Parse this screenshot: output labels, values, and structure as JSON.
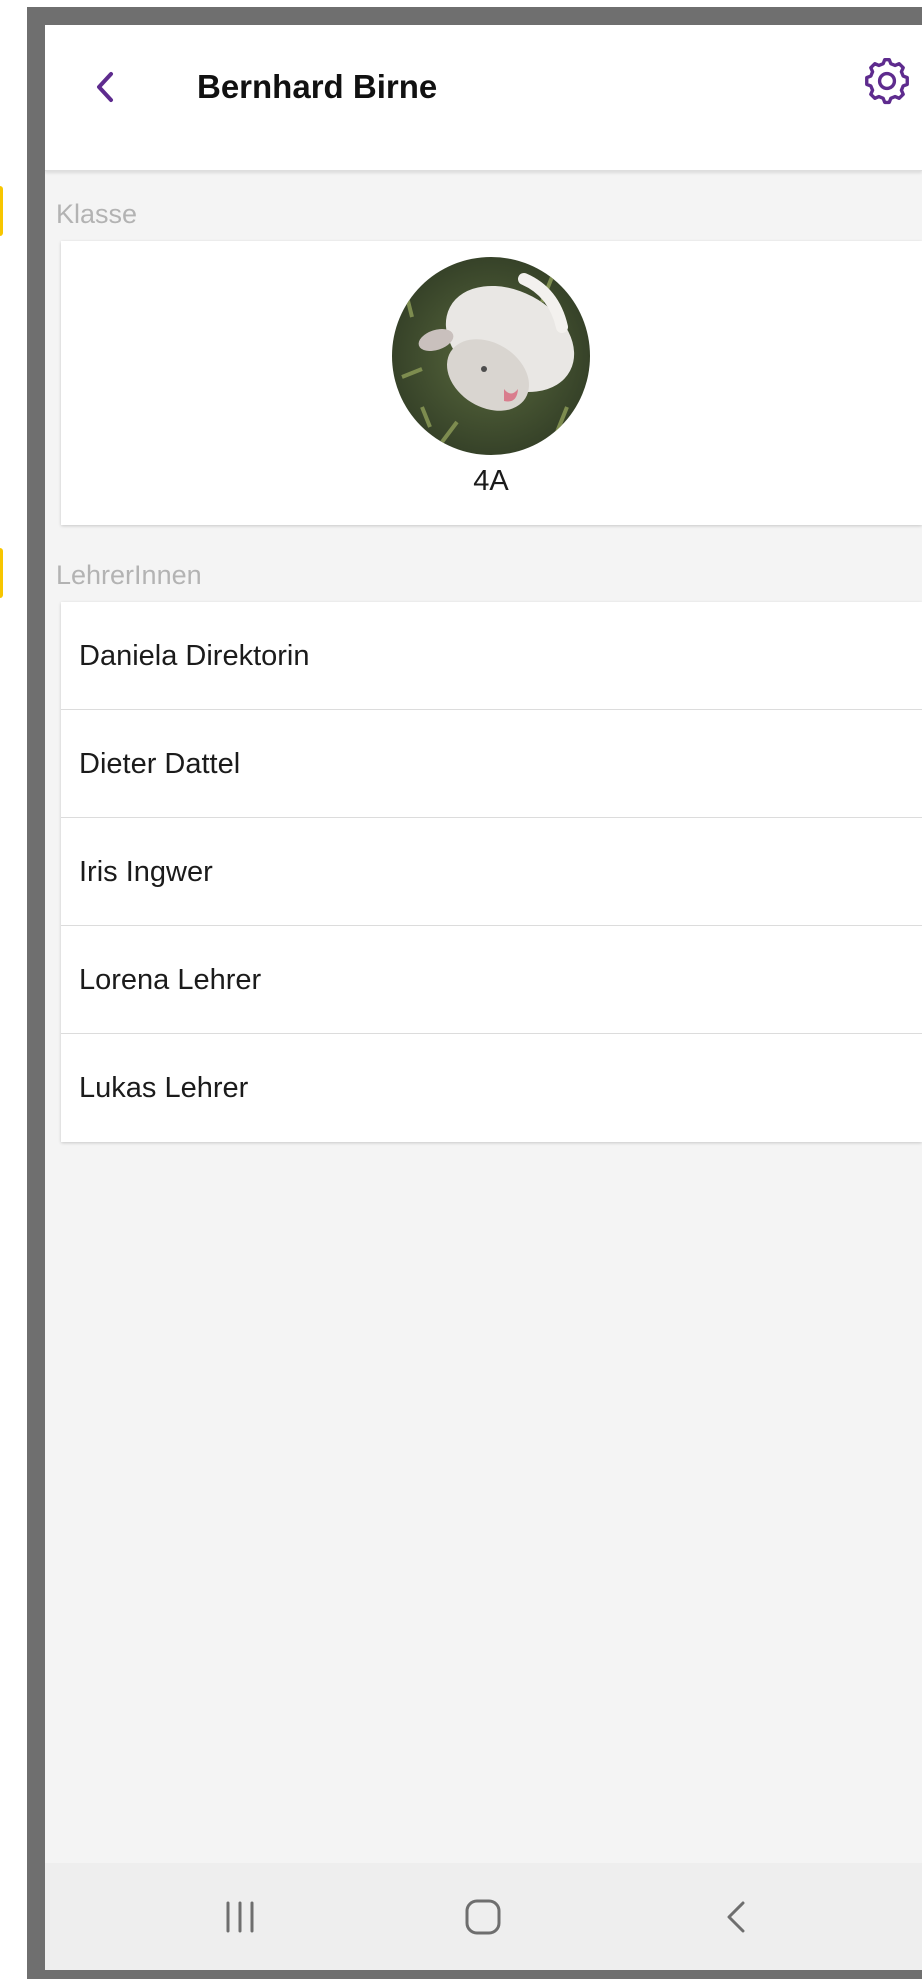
{
  "header": {
    "title": "Bernhard Birne",
    "back_icon": "chevron-left-icon",
    "settings_icon": "gear-icon"
  },
  "class_section": {
    "label": "Klasse",
    "class_name": "4A"
  },
  "teachers_section": {
    "label": "LehrerInnen",
    "items": [
      "Daniela Direktorin",
      "Dieter Dattel",
      "Iris Ingwer",
      "Lorena Lehrer",
      "Lukas Lehrer"
    ]
  },
  "system_nav": {
    "recents_icon": "recents-icon",
    "home_icon": "home-icon",
    "back_icon": "back-icon"
  },
  "colors": {
    "accent": "#5E2B8E",
    "section_label": "#B3B3B3",
    "background": "#F4F4F4",
    "card": "#FFFFFF",
    "marker": "#F7C600"
  }
}
